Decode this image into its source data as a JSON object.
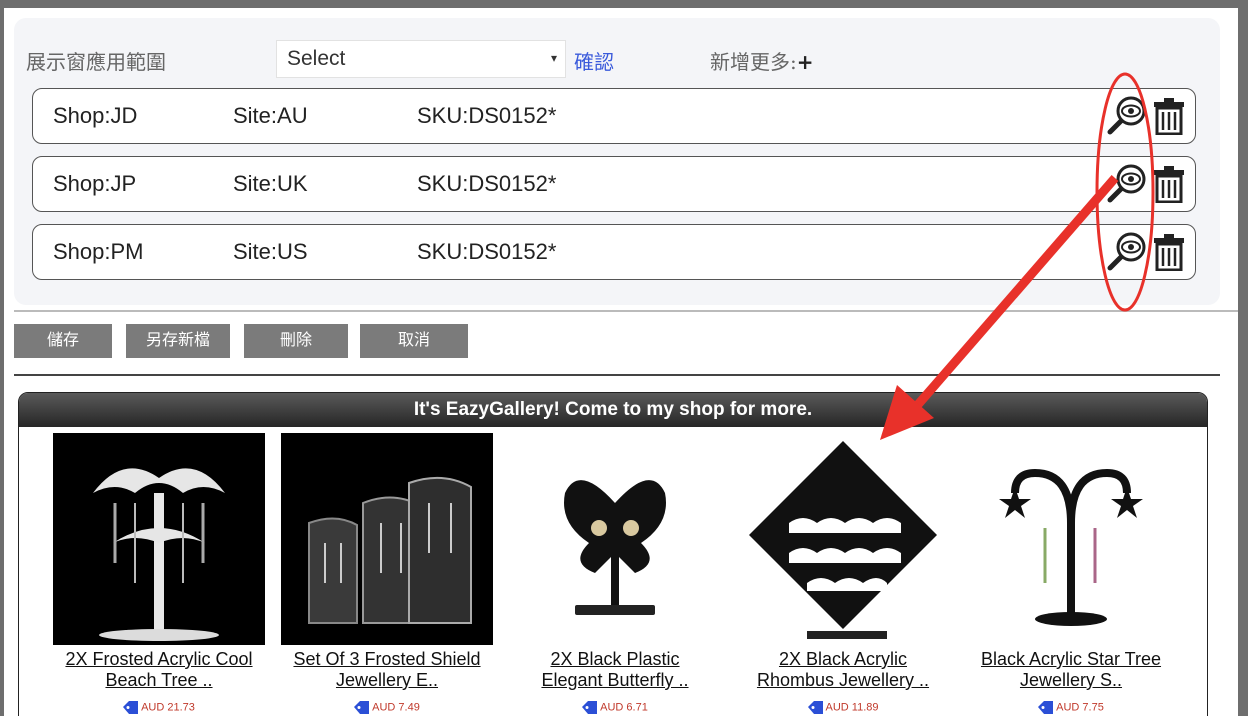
{
  "config": {
    "scope_label": "展示窗應用範圍",
    "select_value": "Select",
    "confirm_label": "確認",
    "add_more_label": "新增更多:",
    "add_more_plus": "+",
    "rules": [
      {
        "shop": "Shop:JD",
        "site": "Site:AU",
        "sku": "SKU:DS0152*",
        "preview_icon": "magnifier-eye-icon",
        "delete_icon": "trash-icon"
      },
      {
        "shop": "Shop:JP",
        "site": "Site:UK",
        "sku": "SKU:DS0152*",
        "preview_icon": "magnifier-eye-icon",
        "delete_icon": "trash-icon"
      },
      {
        "shop": "Shop:PM",
        "site": "Site:US",
        "sku": "SKU:DS0152*",
        "preview_icon": "magnifier-eye-icon",
        "delete_icon": "trash-icon"
      }
    ]
  },
  "actions": {
    "save": "儲存",
    "save_as": "另存新檔",
    "delete": "刪除",
    "cancel": "取消"
  },
  "gallery": {
    "title": "It's EazyGallery! Come to my shop for more.",
    "products": [
      {
        "name_line1": "2X Frosted Acrylic Cool",
        "name_line2": "Beach Tree ..",
        "price": "AUD 21.73"
      },
      {
        "name_line1": "Set Of 3 Frosted Shield",
        "name_line2": "Jewellery E..",
        "price": "AUD 7.49"
      },
      {
        "name_line1": "2X Black Plastic",
        "name_line2": "Elegant Butterfly ..",
        "price": "AUD 6.71"
      },
      {
        "name_line1": "2X Black Acrylic",
        "name_line2": "Rhombus Jewellery ..",
        "price": "AUD 11.89"
      },
      {
        "name_line1": "Black Acrylic Star Tree",
        "name_line2": "Jewellery S..",
        "price": "AUD 7.75"
      }
    ]
  },
  "colors": {
    "link": "#3b5bdb",
    "annotation": "#e8312a",
    "price": "#c0392b",
    "tag": "#2b4fd6"
  }
}
